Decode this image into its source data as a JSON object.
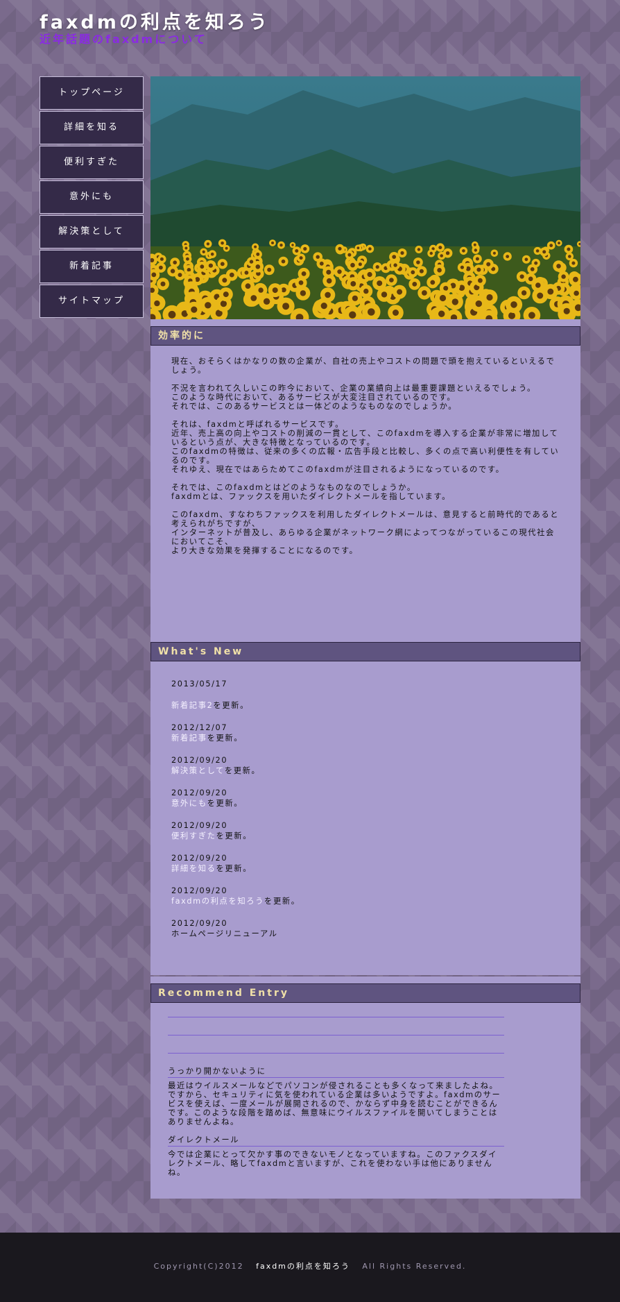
{
  "header": {
    "title": "faxdmの利点を知ろう",
    "subtitle": "近年話題のfaxdmについて"
  },
  "nav": {
    "items": [
      "トップページ",
      "詳細を知る",
      "便利すぎた",
      "意外にも",
      "解決策として",
      "新着記事",
      "サイトマップ"
    ]
  },
  "intro": {
    "heading": "効率的に",
    "paragraphs": [
      "現在、おそらくはかなりの数の企業が、自社の売上やコストの問題で頭を抱えているといえるでしょう。",
      "不況を言われて久しいこの昨今において、企業の業績向上は最重要課題といえるでしょう。\nこのような時代において、あるサービスが大変注目されているのです。\nそれでは、このあるサービスとは一体どのようなものなのでしょうか。",
      "それは、faxdmと呼ばれるサービスです。\n近年、売上高の向上やコストの削減の一貫として、このfaxdmを導入する企業が非常に増加しているという点が、大きな特徴となっているのです。\nこのfaxdmの特徴は、従来の多くの広報・広告手段と比較し、多くの点で高い利便性を有しているのです。\nそれゆえ、現在ではあらためてこのfaxdmが注目されるようになっているのです。",
      "それでは、このfaxdmとはどのようなものなのでしょうか。\nfaxdmとは、ファックスを用いたダイレクトメールを指しています。",
      "このfaxdm、すなわちファックスを利用したダイレクトメールは、意見すると前時代的であると考えられがちですが、\nインターネットが普及し、あらゆる企業がネットワーク網によってつながっているこの現代社会においてこそ、\nより大きな効果を発揮することになるのです。"
    ]
  },
  "news": {
    "heading": "What's New",
    "entries": [
      {
        "date": "2013/05/17",
        "link": "新着記事2",
        "suffix": "を更新。"
      },
      {
        "date": "2012/12/07",
        "link": "新着記事",
        "suffix": "を更新。"
      },
      {
        "date": "2012/09/20",
        "link": "解決策として",
        "suffix": "を更新。"
      },
      {
        "date": "2012/09/20",
        "link": "意外にも",
        "suffix": "を更新。"
      },
      {
        "date": "2012/09/20",
        "link": "便利すぎた",
        "suffix": "を更新。"
      },
      {
        "date": "2012/09/20",
        "link": "詳細を知る",
        "suffix": "を更新。"
      },
      {
        "date": "2012/09/20",
        "link": "faxdmの利点を知ろう",
        "suffix": "を更新。"
      },
      {
        "date": "2012/09/20",
        "link": "",
        "suffix": "ホームページリニューアル"
      }
    ]
  },
  "recommend": {
    "heading": "Recommend Entry",
    "entries": [
      {
        "title": "うっかり開かないように",
        "body": "最近はウイルスメールなどでパソコンが侵されることも多くなって来ましたよね。ですから、セキュリティに気を使われている企業は多いようですよ。faxdmのサービスを使えば、一度メールが展開されるので、かならず中身を読むことができるんです。このような段階を踏めば、無意味にウイルスファイルを開いてしまうことはありませんよね。"
      },
      {
        "title": "ダイレクトメール",
        "body": "今では企業にとって欠かす事のできないモノとなっていますね。このファクスダイレクトメール、略してfaxdmと言いますが、これを使わない手は他にありませんね。"
      }
    ]
  },
  "footer": {
    "prefix": "Copyright(C)2012",
    "site": "faxdmの利点を知ろう",
    "suffix": "All Rights Reserved."
  },
  "colors": {
    "nav_bg": "#342a48",
    "content_bg": "#a89cce",
    "heading_bar": "#5f5480",
    "heading_text": "#f0e0a8",
    "subtitle": "#8a2be2",
    "footer_bg": "#1a181e"
  }
}
